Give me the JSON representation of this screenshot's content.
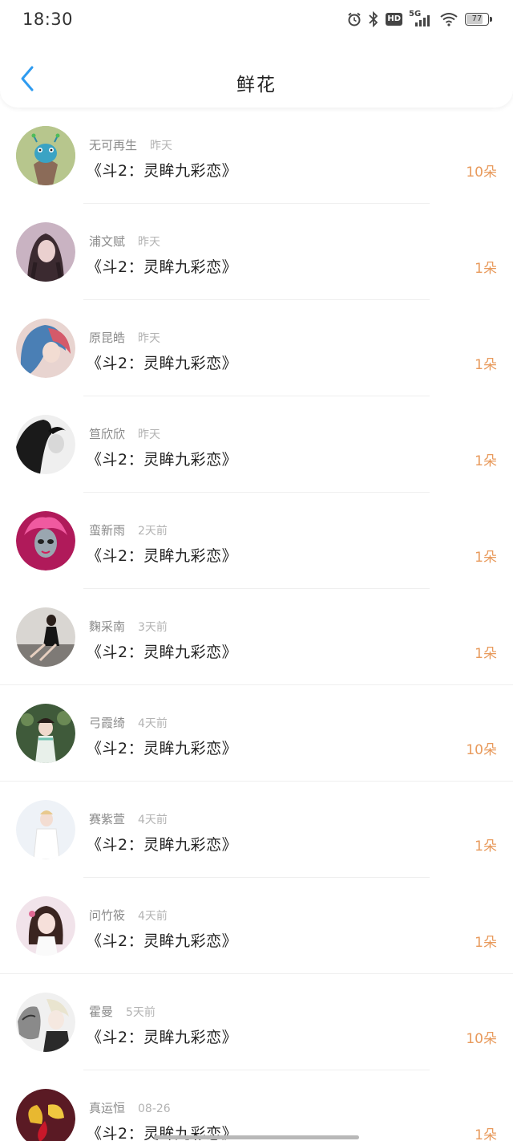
{
  "status_bar": {
    "time": "18:30",
    "network": "5G",
    "hd": "HD",
    "battery": "77"
  },
  "header": {
    "title": "鲜花"
  },
  "items": [
    {
      "name": "无可再生",
      "time": "昨天",
      "title": "《斗2：灵眸九彩恋》",
      "count": "10朵"
    },
    {
      "name": "浦文赋",
      "time": "昨天",
      "title": "《斗2：灵眸九彩恋》",
      "count": "1朵"
    },
    {
      "name": "原昆皓",
      "time": "昨天",
      "title": "《斗2：灵眸九彩恋》",
      "count": "1朵"
    },
    {
      "name": "笪欣欣",
      "time": "昨天",
      "title": "《斗2：灵眸九彩恋》",
      "count": "1朵"
    },
    {
      "name": "蛮新雨",
      "time": "2天前",
      "title": "《斗2：灵眸九彩恋》",
      "count": "1朵"
    },
    {
      "name": "麴采南",
      "time": "3天前",
      "title": "《斗2：灵眸九彩恋》",
      "count": "1朵"
    },
    {
      "name": "弓霞绮",
      "time": "4天前",
      "title": "《斗2：灵眸九彩恋》",
      "count": "10朵"
    },
    {
      "name": "赛紫萱",
      "time": "4天前",
      "title": "《斗2：灵眸九彩恋》",
      "count": "1朵"
    },
    {
      "name": "问竹筱",
      "time": "4天前",
      "title": "《斗2：灵眸九彩恋》",
      "count": "1朵"
    },
    {
      "name": "霍曼",
      "time": "5天前",
      "title": "《斗2：灵眸九彩恋》",
      "count": "10朵"
    },
    {
      "name": "真运恒",
      "time": "08-26",
      "title": "《斗2：灵眸九彩恋》",
      "count": "1朵"
    }
  ],
  "colors": {
    "accent": "#2e9bf0",
    "count": "#e89a5c"
  }
}
